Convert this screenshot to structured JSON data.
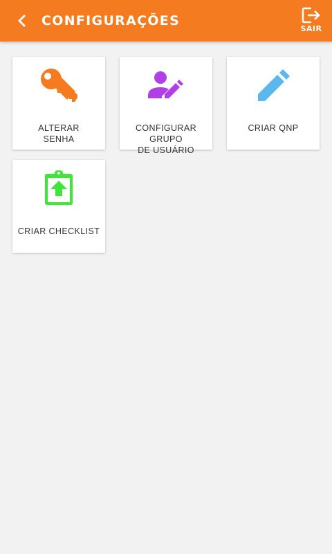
{
  "header": {
    "title": "CONFIGURAÇÕES",
    "back_icon": "chevron-left-icon",
    "exit_label": "SAIR",
    "exit_icon": "logout-icon",
    "background_color": "#f47b20"
  },
  "tiles": [
    {
      "label": "ALTERAR\nSENHA",
      "icon": "key-icon",
      "color": "#f47b20"
    },
    {
      "label": "CONFIGURAR GRUPO\nDE USUÁRIO",
      "icon": "user-edit-icon",
      "color": "#b13fe8"
    },
    {
      "label": "CRIAR QNP",
      "icon": "pencil-icon",
      "color": "#5bb8ee"
    },
    {
      "label": "CRIAR CHECKLIST",
      "icon": "clipboard-upload-icon",
      "color": "#3ee63a"
    }
  ]
}
